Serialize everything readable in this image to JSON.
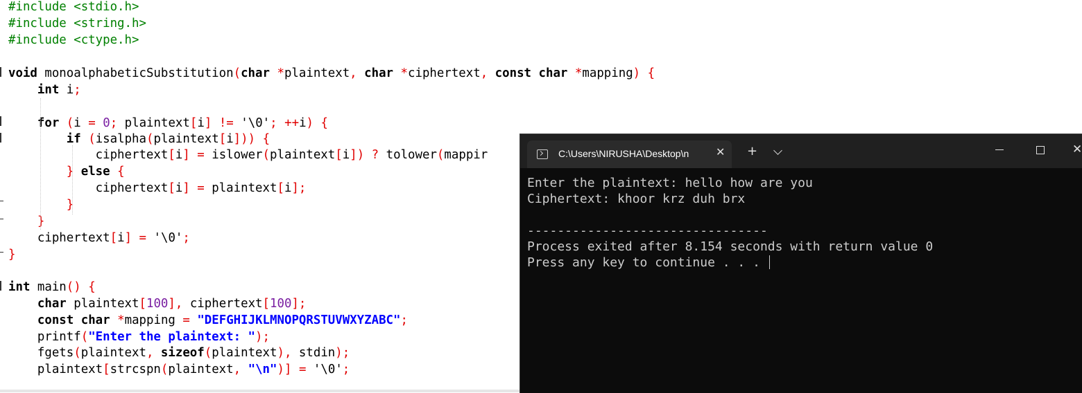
{
  "editor": {
    "lines": [
      [
        "#include <stdio.h>"
      ],
      [
        "#include <string.h>"
      ],
      [
        "#include <ctype.h>"
      ],
      [
        ""
      ],
      [
        "void",
        " monoalphabeticSubstitution",
        "(",
        "char",
        " ",
        "*",
        "plaintext",
        ",",
        " ",
        "char",
        " ",
        "*",
        "ciphertext",
        ",",
        " ",
        "const",
        " ",
        "char",
        " ",
        "*",
        "mapping",
        ")",
        " ",
        "{"
      ],
      [
        "    ",
        "int",
        " i",
        ";"
      ],
      [
        ""
      ],
      [
        "    ",
        "for",
        " ",
        "(",
        "i ",
        "=",
        " ",
        "0",
        ";",
        " plaintext",
        "[",
        "i",
        "]",
        " ",
        "!=",
        " ",
        "'\\0'",
        ";",
        " ",
        "++",
        "i",
        ")",
        " ",
        "{"
      ],
      [
        "        ",
        "if",
        " ",
        "(",
        "isalpha",
        "(",
        "plaintext",
        "[",
        "i",
        "]",
        ")",
        ")",
        " ",
        "{"
      ],
      [
        "            ciphertext",
        "[",
        "i",
        "]",
        " ",
        "=",
        " islower",
        "(",
        "plaintext",
        "[",
        "i",
        "]",
        ")",
        " ",
        "?",
        " tolower",
        "(",
        "mappir"
      ],
      [
        "        ",
        "}",
        " ",
        "else",
        " ",
        "{"
      ],
      [
        "            ciphertext",
        "[",
        "i",
        "]",
        " ",
        "=",
        " plaintext",
        "[",
        "i",
        "]",
        ";"
      ],
      [
        "        ",
        "}"
      ],
      [
        "    ",
        "}"
      ],
      [
        "    ciphertext",
        "[",
        "i",
        "]",
        " ",
        "=",
        " ",
        "'\\0'",
        ";"
      ],
      [
        "}"
      ],
      [
        ""
      ],
      [
        "int",
        " main",
        "(",
        ")",
        " ",
        "{"
      ],
      [
        "    ",
        "char",
        " plaintext",
        "[",
        "100",
        "]",
        ",",
        " ciphertext",
        "[",
        "100",
        "]",
        ";"
      ],
      [
        "    ",
        "const",
        " ",
        "char",
        " ",
        "*",
        "mapping ",
        "=",
        " ",
        "\"DEFGHIJKLMNOPQRSTUVWXYZABC\"",
        ";"
      ],
      [
        "    printf",
        "(",
        "\"Enter the plaintext: \"",
        ")",
        ";"
      ],
      [
        "    fgets",
        "(",
        "plaintext",
        ",",
        " ",
        "sizeof",
        "(",
        "plaintext",
        ")",
        ",",
        " stdin",
        ")",
        ";"
      ],
      [
        "    plaintext",
        "[",
        "strcspn",
        "(",
        "plaintext",
        ",",
        " ",
        "\"\\n\"",
        ")",
        "]",
        " ",
        "=",
        " ",
        "'\\0'",
        ";"
      ]
    ]
  },
  "terminal": {
    "tab_title": "C:\\Users\\NIRUSHA\\Desktop\\n",
    "tab_close": "✕",
    "new_tab": "+",
    "win_close": "✕",
    "output": [
      "Enter the plaintext: hello how are you",
      "Ciphertext: khoor krz duh brx",
      "",
      "--------------------------------",
      "Process exited after 8.154 seconds with return value 0",
      "Press any key to continue . . . "
    ]
  }
}
